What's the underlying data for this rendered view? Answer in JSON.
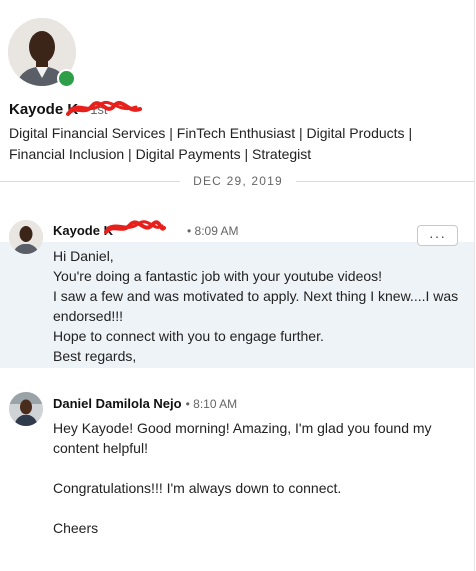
{
  "profile": {
    "name": "Kayode K",
    "degree": "1st",
    "headline": "Digital Financial Services | FinTech Enthusiast | Digital Products | Financial Inclusion | Digital Payments | Strategist",
    "presence_color": "#2e9e48"
  },
  "conversation": {
    "date": "DEC 29, 2019",
    "messages": [
      {
        "sender": "Kayode K",
        "time": "8:09 AM",
        "lines": [
          "Hi Daniel,",
          "You're doing a fantastic job with your youtube videos!",
          "I saw a few and was motivated to apply. Next thing I knew....I was endorsed!!!",
          "Hope to connect with you to engage further.",
          "Best regards,"
        ]
      },
      {
        "sender": "Daniel Damilola Nejo",
        "time": "8:10 AM",
        "lines": [
          "Hey Kayode! Good morning! Amazing, I'm glad you found my content helpful!",
          "",
          "Congratulations!!! I'm always down to connect.",
          "",
          "Cheers"
        ]
      }
    ],
    "more_icon": "ellipsis-icon",
    "more_label": "···"
  },
  "colors": {
    "highlight_bg": "#eef3f8",
    "redaction": "#e8201c"
  }
}
